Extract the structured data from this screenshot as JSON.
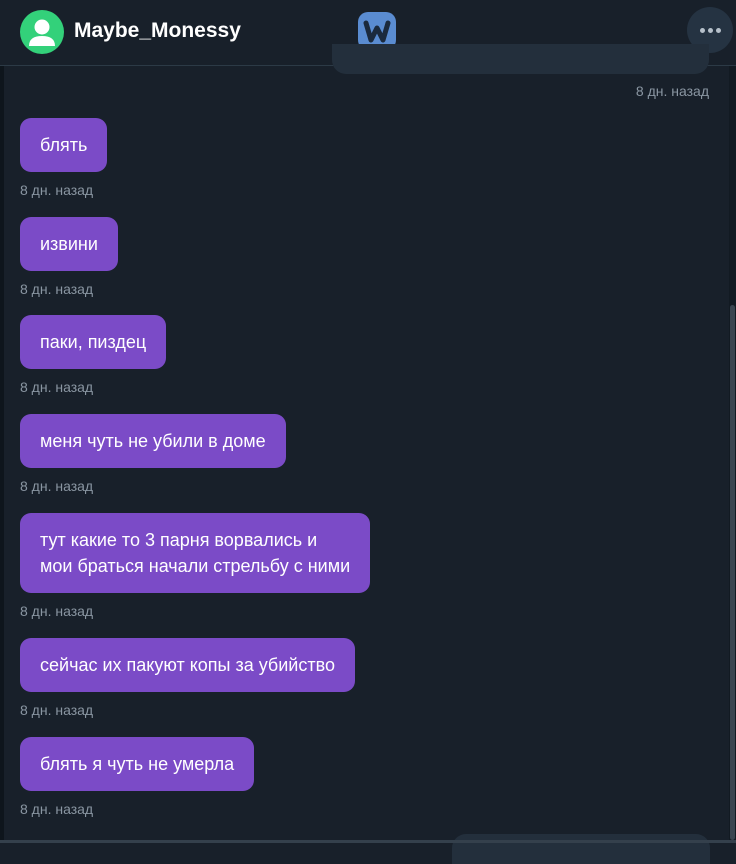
{
  "header": {
    "username": "Maybe_Monessy",
    "logo_letter": "w",
    "avatar_icon": "user-icon",
    "more_icon": "more-horizontal-icon"
  },
  "colors": {
    "background": "#18202a",
    "bubble_incoming": "#7b4bc7",
    "avatar": "#33d17a",
    "logo": "#5a8cd1"
  },
  "thread": {
    "top_outgoing_time": "8 дн. назад",
    "messages": [
      {
        "text": "блять",
        "time": "8 дн. назад"
      },
      {
        "text": "извини",
        "time": "8 дн. назад"
      },
      {
        "text": "паки, пиздец",
        "time": "8 дн. назад"
      },
      {
        "text": "меня чуть не убили в доме",
        "time": "8 дн. назад"
      },
      {
        "text": "тут какие то 3 парня ворвались и\nмои браться начали стрельбу с ними",
        "time": "8 дн. назад"
      },
      {
        "text": "сейчас их пакуют копы за убийство",
        "time": "8 дн. назад"
      },
      {
        "text": "блять я чуть не умерла",
        "time": "8 дн. назад"
      }
    ]
  }
}
